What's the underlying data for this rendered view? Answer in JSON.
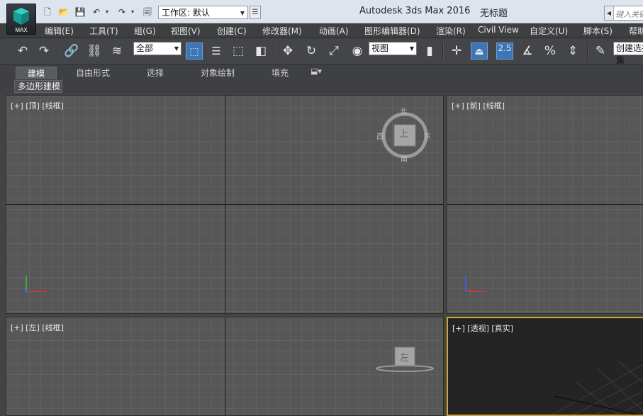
{
  "app": {
    "logo_label": "MAX",
    "title": "Autodesk 3ds Max 2016",
    "doc_title": "无标题"
  },
  "workspace": {
    "label": "工作区: 默认"
  },
  "search": {
    "placeholder": "键入关键字"
  },
  "menu": [
    "编辑(E)",
    "工具(T)",
    "组(G)",
    "视图(V)",
    "创建(C)",
    "修改器(M)",
    "动画(A)",
    "图形编辑器(D)",
    "渲染(R)",
    "Civil View",
    "自定义(U)",
    "脚本(S)",
    "帮助"
  ],
  "toolbar": {
    "selection_filter": "全部",
    "ref_coord": "视图",
    "snap_value": "2.5",
    "named_selection": "创建选择集"
  },
  "ribbon": {
    "tabs": [
      "建模",
      "自由形式",
      "选择",
      "对象绘制",
      "填充"
    ],
    "panel_label": "多边形建模"
  },
  "viewports": {
    "top": {
      "label": "[+] [顶] [线框]",
      "cube_face": "上",
      "compass": [
        "北",
        "南",
        "东",
        "西"
      ]
    },
    "front": {
      "label": "[+] [前] [线框]"
    },
    "left": {
      "label": "[+] [左] [线框]",
      "cube_face": "左"
    },
    "perspective": {
      "label": "[+] [透视] [真实]"
    }
  },
  "colors": {
    "accent_blue": "#3c76b6",
    "active_viewport_border": "#d4a535",
    "menu_bg": "#3e3f41",
    "viewport_bg": "#575757"
  }
}
